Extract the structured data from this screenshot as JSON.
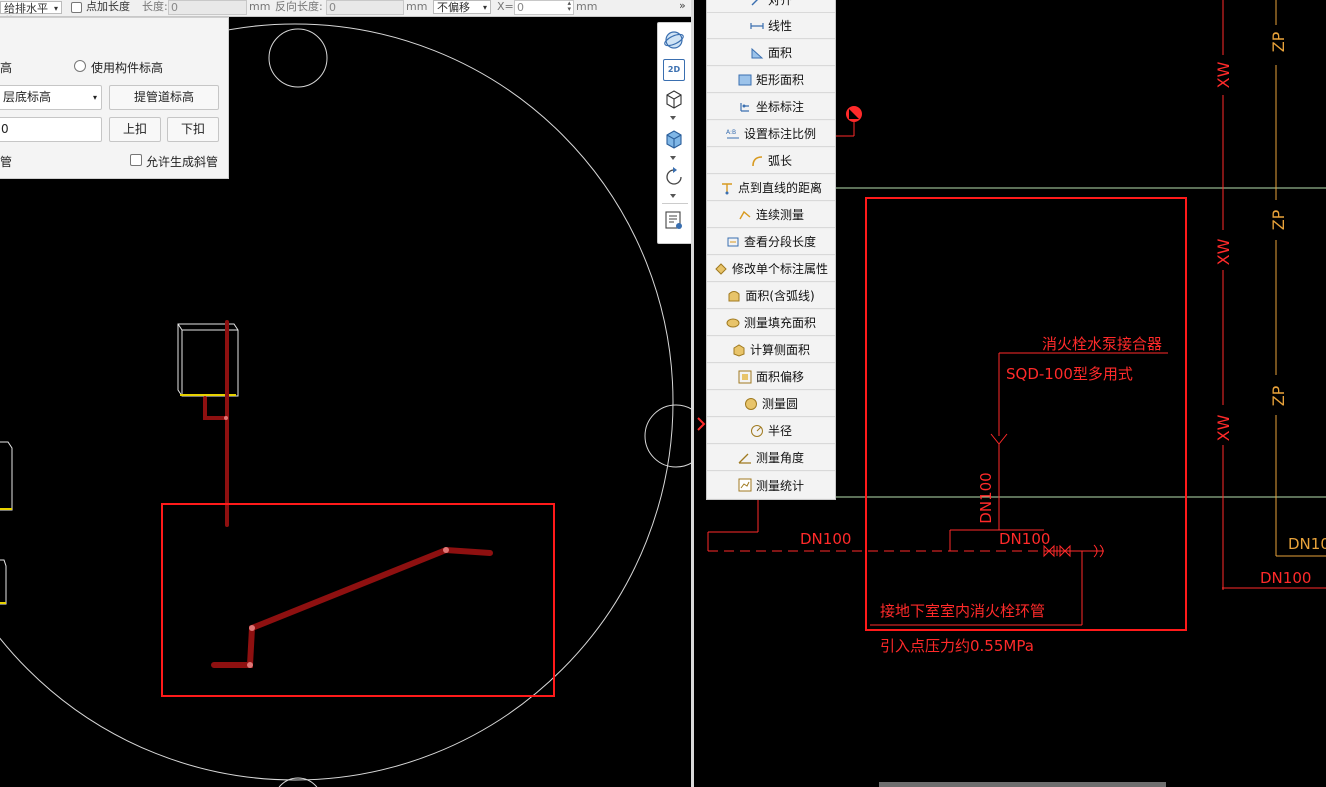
{
  "toolbar": {
    "horizontal_mode": "给排水平值",
    "add_length_label": "点加长度",
    "length_label": "长度:",
    "length_value": "0",
    "unit_mm": "mm",
    "reverse_length_label": "反向长度:",
    "reverse_length_value": "0",
    "offset_mode": "不偏移",
    "x_label": "X=",
    "x_value": "0",
    "more": "»"
  },
  "elevation_panel": {
    "radio_left_label": "高",
    "radio_component_label": "使用构件标高",
    "base_select": "层底标高",
    "riser_button": "提管道标高",
    "value_input": "0",
    "up_button": "上扣",
    "down_button": "下扣",
    "pipe_label": "管",
    "allow_slope_label": "允许生成斜管"
  },
  "measure_menu": {
    "items": [
      {
        "label": "对齐",
        "icon": "align-dimension-icon"
      },
      {
        "label": "线性",
        "icon": "linear-dimension-icon"
      },
      {
        "label": "面积",
        "icon": "area-icon"
      },
      {
        "label": "矩形面积",
        "icon": "rect-area-icon"
      },
      {
        "label": "坐标标注",
        "icon": "coordinate-dimension-icon"
      },
      {
        "label": "设置标注比例",
        "icon": "dimension-scale-icon"
      },
      {
        "label": "弧长",
        "icon": "arc-length-icon"
      },
      {
        "label": "点到直线的距离",
        "icon": "point-line-distance-icon"
      },
      {
        "label": "连续测量",
        "icon": "continuous-measure-icon"
      },
      {
        "label": "查看分段长度",
        "icon": "segment-length-icon"
      },
      {
        "label": "修改单个标注属性",
        "icon": "edit-dimension-icon"
      },
      {
        "label": "面积(含弧线)",
        "icon": "area-arc-icon"
      },
      {
        "label": "测量填充面积",
        "icon": "fill-area-icon"
      },
      {
        "label": "计算侧面积",
        "icon": "side-area-icon"
      },
      {
        "label": "面积偏移",
        "icon": "area-offset-icon"
      },
      {
        "label": "测量圆",
        "icon": "measure-circle-icon"
      },
      {
        "label": "半径",
        "icon": "radius-icon"
      },
      {
        "label": "测量角度",
        "icon": "measure-angle-icon"
      },
      {
        "label": "测量统计",
        "icon": "measure-stats-icon"
      }
    ]
  },
  "view_toolbar": {
    "icons": [
      "orbit-icon",
      "2d-view-icon",
      "3d-box-icon",
      "solid-box-icon",
      "rotate-icon",
      "properties-icon"
    ],
    "view_2d_label": "2D"
  },
  "cad": {
    "pipe_label_xw": "XW",
    "pipe_label_zp": "ZP",
    "connector_title": "消火栓水泵接合器",
    "connector_model": "SQD-100型多用式",
    "dn100": "DN100",
    "main_pipe_note": "接地下室室内消火栓环管",
    "pressure_note": "引入点压力约0.55MPa"
  },
  "colors": {
    "cad_red": "#ff2a2a",
    "cad_orange": "#e8a23a",
    "highlight_red": "#ff1a1a",
    "pipe_3d": "#8e1010",
    "green_line": "#b8e0b0"
  }
}
